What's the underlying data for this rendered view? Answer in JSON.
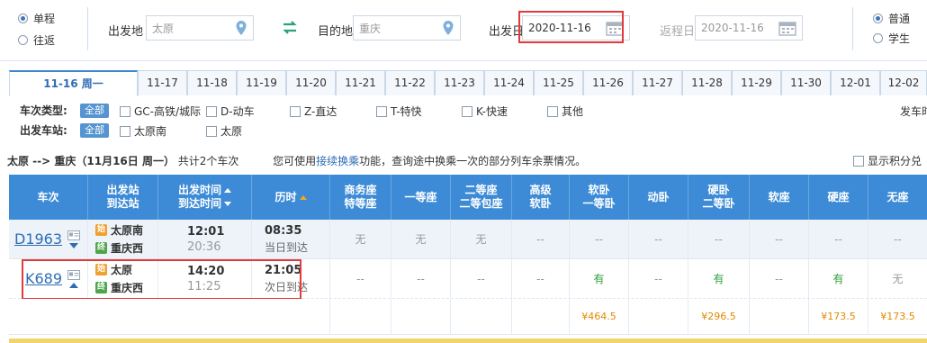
{
  "search": {
    "trip_types": [
      {
        "label": "单程",
        "checked": true
      },
      {
        "label": "往返",
        "checked": false
      }
    ],
    "from_label": "出发地",
    "from_value": "太原",
    "to_label": "目的地",
    "to_value": "重庆",
    "depart_label": "出发日",
    "depart_value": "2020-11-16",
    "return_label": "返程日",
    "return_value": "2020-11-16",
    "ticket_types": [
      {
        "label": "普通",
        "checked": true
      },
      {
        "label": "学生",
        "checked": false
      }
    ]
  },
  "date_tabs": [
    "11-16 周一",
    "11-17",
    "11-18",
    "11-19",
    "11-20",
    "11-21",
    "11-22",
    "11-23",
    "11-24",
    "11-25",
    "11-26",
    "11-27",
    "11-28",
    "11-29",
    "11-30",
    "12-01",
    "12-02"
  ],
  "filters": {
    "train_type_label": "车次类型:",
    "station_label": "出发车站:",
    "all_label": "全部",
    "train_types": [
      "GC-高铁/城际",
      "D-动车",
      "Z-直达",
      "T-特快",
      "K-快速",
      "其他"
    ],
    "stations": [
      "太原南",
      "太原"
    ],
    "depart_time_label": "发车时"
  },
  "summary": {
    "route": "太原 --> 重庆（11月16日  周一）",
    "count": "共计2个车次",
    "prefix": "您可使用",
    "link": "接续换乘",
    "suffix": "功能，查询途中换乘一次的部分列车余票情况。",
    "points_label": "显示积分兑"
  },
  "table": {
    "headers": [
      {
        "l1": "车次",
        "l2": ""
      },
      {
        "l1": "出发站",
        "l2": "到达站"
      },
      {
        "l1": "出发时间",
        "l2": "到达时间"
      },
      {
        "l1": "历时",
        "l2": ""
      },
      {
        "l1": "商务座",
        "l2": "特等座"
      },
      {
        "l1": "一等座",
        "l2": ""
      },
      {
        "l1": "二等座",
        "l2": "二等包座"
      },
      {
        "l1": "高级",
        "l2": "软卧"
      },
      {
        "l1": "软卧",
        "l2": "一等卧"
      },
      {
        "l1": "动卧",
        "l2": ""
      },
      {
        "l1": "硬卧",
        "l2": "二等卧"
      },
      {
        "l1": "软座",
        "l2": ""
      },
      {
        "l1": "硬座",
        "l2": ""
      },
      {
        "l1": "无座",
        "l2": ""
      }
    ],
    "rows": [
      {
        "train": "D1963",
        "from": "太原南",
        "to": "重庆西",
        "depart": "12:01",
        "arrive": "20:36",
        "duration": "08:35",
        "arrival_day": "当日到达",
        "seats": [
          "无",
          "无",
          "无",
          "--",
          "--",
          "--",
          "--",
          "--",
          "--",
          "--"
        ]
      },
      {
        "train": "K689",
        "from": "太原",
        "to": "重庆西",
        "depart": "14:20",
        "arrive": "11:25",
        "duration": "21:05",
        "arrival_day": "次日到达",
        "seats": [
          "--",
          "--",
          "--",
          "--",
          "有",
          "--",
          "有",
          "--",
          "有",
          "无"
        ],
        "prices": [
          "",
          "",
          "",
          "",
          "¥464.5",
          "",
          "¥296.5",
          "",
          "¥173.5",
          "¥173.5"
        ]
      }
    ],
    "start_badge": "始",
    "end_badge": "终"
  }
}
